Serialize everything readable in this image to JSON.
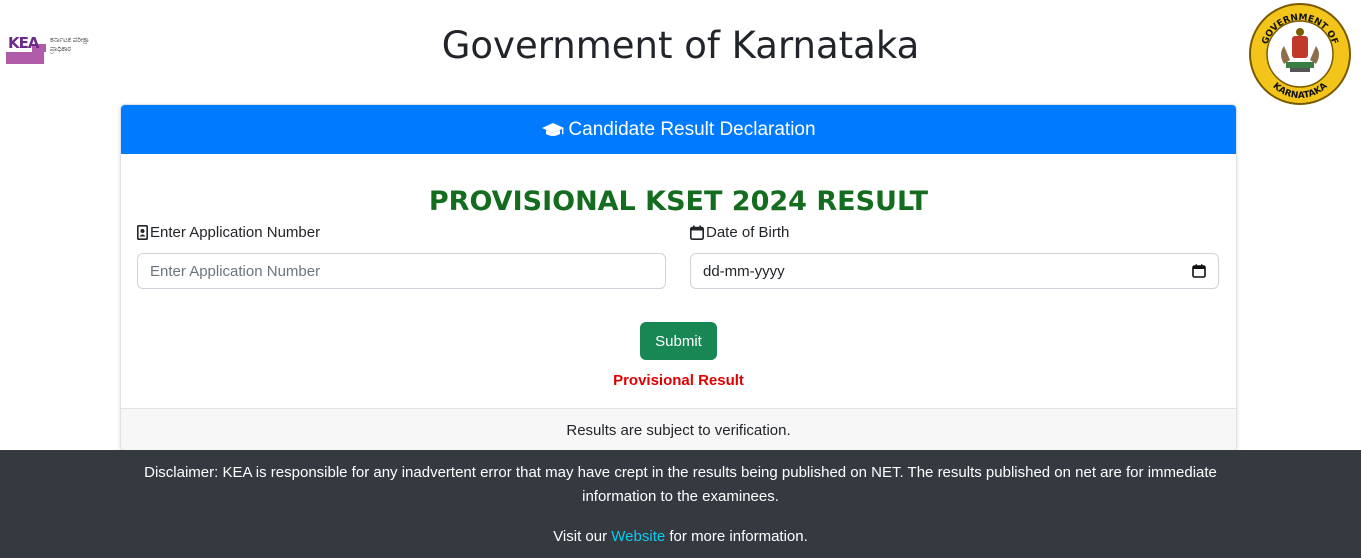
{
  "header": {
    "logo_letters": "KEA",
    "logo_text": "ಕರ್ನಾಟಕ ಪರೀಕ್ಷಾ ಪ್ರಾಧಿಕಾರ",
    "title": "Government of Karnataka",
    "emblem_text_top": "GOVERNMENT OF",
    "emblem_text_bottom": "KARNATAKA"
  },
  "card": {
    "header_title": "Candidate Result Declaration",
    "header_icon": "graduation-cap-icon",
    "result_title": "PROVISIONAL KSET 2024 RESULT",
    "application_label": "Enter Application Number",
    "application_icon": "id-badge-icon",
    "application_placeholder": "Enter Application Number",
    "application_value": "",
    "dob_label": "Date of Birth",
    "dob_icon": "calendar-icon",
    "dob_value": "dd-mm-yyyy",
    "submit_label": "Submit",
    "provisional_note": "Provisional Result",
    "footer_text": "Results are subject to verification."
  },
  "footer": {
    "disclaimer": "Disclaimer: KEA is responsible for any inadvertent error that may have crept in the results being published on NET. The results published on net are for immediate information to the examinees.",
    "visit_prefix": "Visit our",
    "website_link": "Website",
    "visit_suffix": "for more information."
  },
  "colors": {
    "primary": "#007bff",
    "success": "#198754",
    "title_green": "#146c1f",
    "danger": "#e00000",
    "footer_bg": "#343a40",
    "link": "#0dcaf0"
  }
}
